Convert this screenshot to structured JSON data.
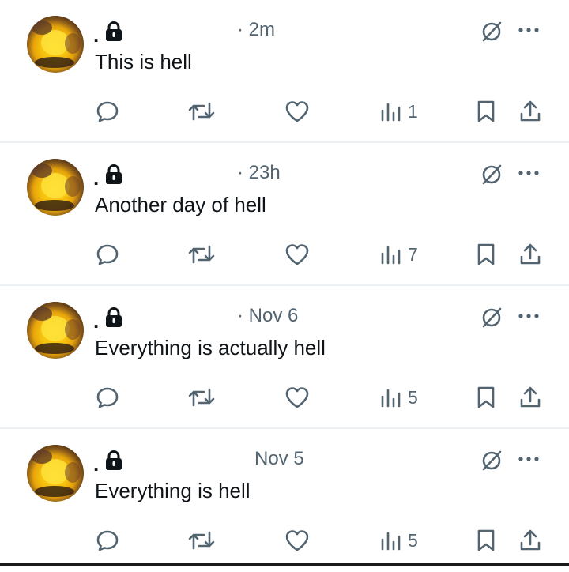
{
  "tweets": [
    {
      "name": ".",
      "timestamp": "· 2m",
      "text": "This is hell",
      "views": "1"
    },
    {
      "name": ".",
      "timestamp": "· 23h",
      "text": "Another day of hell",
      "views": "7"
    },
    {
      "name": ".",
      "timestamp": "· Nov 6",
      "text": "Everything is actually hell",
      "views": "5"
    },
    {
      "name": ".",
      "timestamp": "Nov 5",
      "text": "Everything is hell",
      "views": "5"
    }
  ],
  "icons": {
    "lock": "lock-icon",
    "grok": "grok-icon",
    "more": "more-icon",
    "reply": "reply-icon",
    "retweet": "retweet-icon",
    "like": "heart-icon",
    "views": "views-icon",
    "bookmark": "bookmark-icon",
    "share": "share-icon"
  },
  "colors": {
    "text": "#0f1419",
    "secondary": "#536471",
    "divider": "#eef1f3"
  }
}
